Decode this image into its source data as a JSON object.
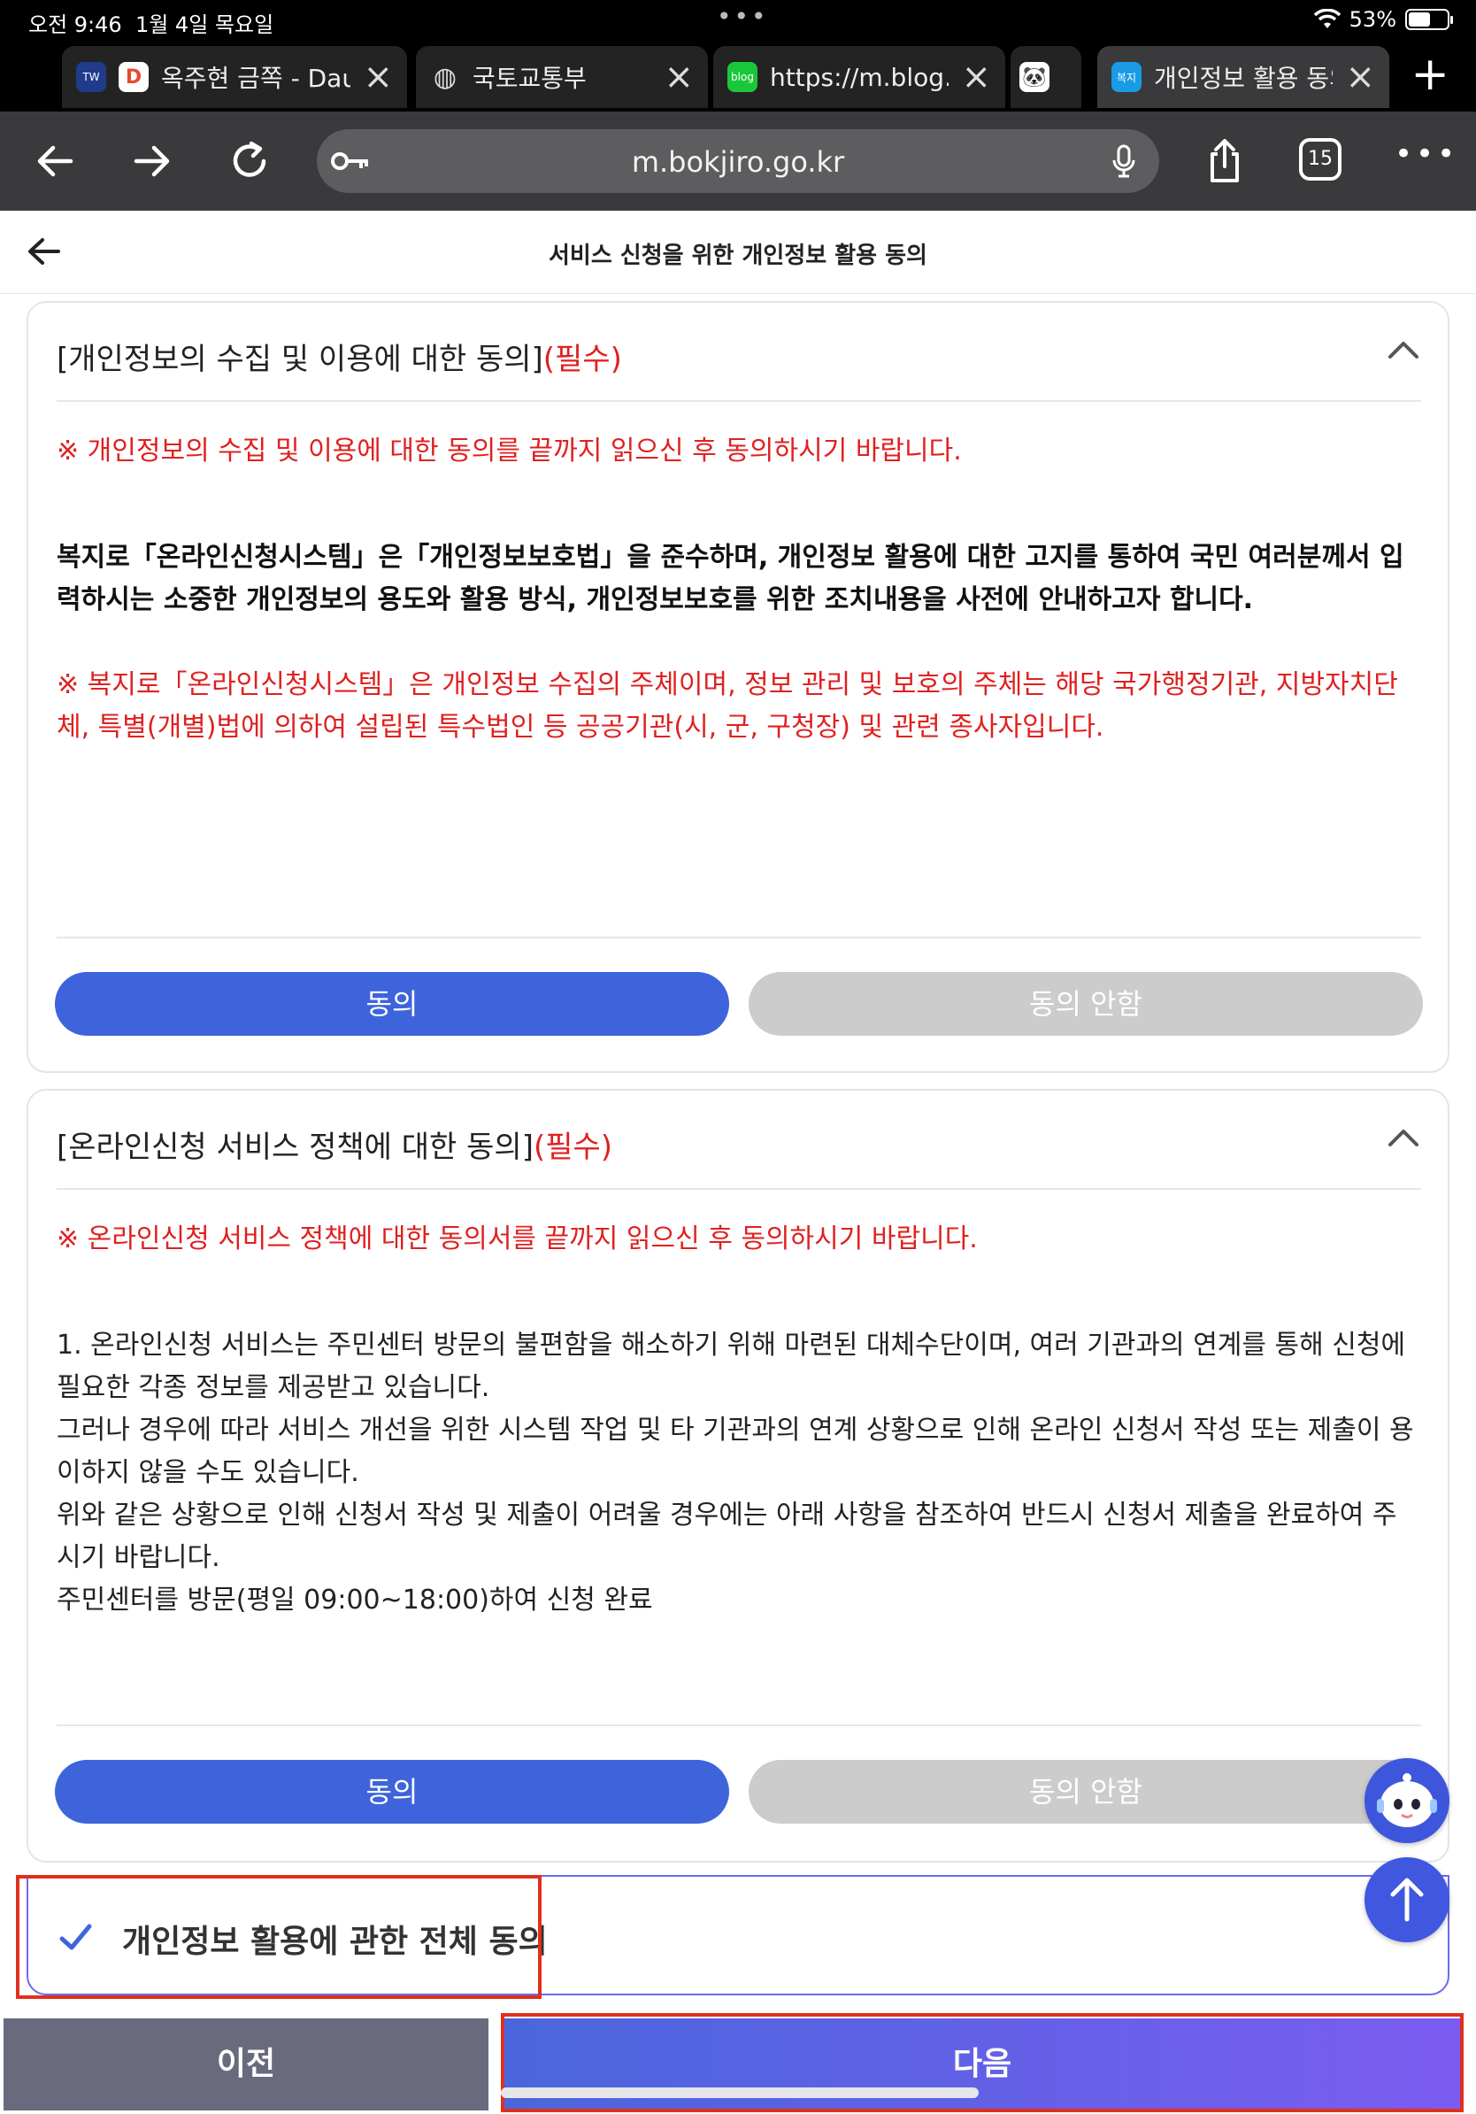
{
  "status_bar": {
    "time": "오전 9:46",
    "date": "1월 4일 목요일",
    "battery": "53%"
  },
  "tabs": [
    {
      "title": "옥주현 금쪽 - Dau"
    },
    {
      "title": "국토교통부"
    },
    {
      "title": "https://m.blog.n"
    },
    {
      "title": ""
    },
    {
      "title": "개인정보 활용 동의"
    }
  ],
  "toolbar": {
    "url": "m.bokjiro.go.kr",
    "tab_count": "15"
  },
  "page": {
    "title": "서비스 신청을 위한 개인정보 활용 동의"
  },
  "sections": [
    {
      "heading": "[개인정보의 수집 및 이용에 대한 동의]",
      "required": "(필수)",
      "notice": "※ 개인정보의 수집 및 이용에 대한 동의를 끝까지 읽으신 후 동의하시기 바랍니다.",
      "body_bold": "복지로「온라인신청시스템」은「개인정보보호법」을 준수하며, 개인정보 활용에 대한 고지를 통하여 국민 여러분께서 입력하시는 소중한 개인정보의 용도와 활용 방식, 개인정보보호를 위한 조치내용을 사전에 안내하고자 합니다.",
      "body_red": "※ 복지로「온라인신청시스템」은 개인정보 수집의 주체이며, 정보 관리 및 보호의 주체는 해당 국가행정기관, 지방자치단체, 특별(개별)법에 의하여 설립된 특수법인 등 공공기관(시, 군, 구청장) 및 관련 종사자입니다.",
      "agree": "동의",
      "disagree": "동의 안함"
    },
    {
      "heading": "[온라인신청 서비스 정책에 대한 동의]",
      "required": "(필수)",
      "notice": "※ 온라인신청 서비스 정책에 대한 동의서를 끝까지 읽으신 후 동의하시기 바랍니다.",
      "body": [
        "1. 온라인신청 서비스는 주민센터 방문의 불편함을 해소하기 위해 마련된 대체수단이며, 여러 기관과의 연계를 통해 신청에 필요한 각종 정보를 제공받고 있습니다.",
        "그러나 경우에 따라 서비스 개선을 위한 시스템 작업 및 타 기관과의 연계 상황으로 인해 온라인 신청서 작성 또는 제출이 용이하지 않을 수도 있습니다.",
        "위와 같은 상황으로 인해 신청서 작성 및 제출이 어려울 경우에는 아래 사항을 참조하여 반드시 신청서 제출을 완료하여 주시기 바랍니다.",
        "주민센터를 방문(평일 09:00~18:00)하여 신청 완료"
      ],
      "agree": "동의",
      "disagree": "동의 안함"
    }
  ],
  "all_agree": {
    "label": "개인정보 활용에 관한 전체 동의",
    "checked": true
  },
  "footer": {
    "prev": "이전",
    "next": "다음"
  },
  "colors": {
    "primary": "#3e64dc",
    "required": "#e02020",
    "disabled": "#cccccc",
    "highlight": "#e0301e"
  }
}
